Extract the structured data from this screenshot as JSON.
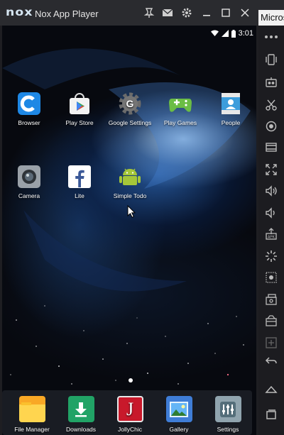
{
  "window": {
    "logo": "nox",
    "title": "Nox App Player",
    "buttons": [
      "pin-icon",
      "mail-icon",
      "settings-icon",
      "minimize-icon",
      "maximize-icon",
      "close-icon"
    ]
  },
  "side_window": {
    "tab_text": "Micros"
  },
  "status_bar": {
    "time": "3:01",
    "icons": [
      "wifi-icon",
      "signal-icon",
      "battery-icon"
    ]
  },
  "home_apps": [
    {
      "label": "Browser",
      "icon": "browser-icon"
    },
    {
      "label": "Play Store",
      "icon": "play-store-icon"
    },
    {
      "label": "Google Settings",
      "icon": "google-settings-icon"
    },
    {
      "label": "Play Games",
      "icon": "play-games-icon"
    },
    {
      "label": "People",
      "icon": "people-icon"
    },
    {
      "label": "Camera",
      "icon": "camera-icon"
    },
    {
      "label": "Lite",
      "icon": "facebook-lite-icon"
    },
    {
      "label": "Simple Todo",
      "icon": "android-icon"
    }
  ],
  "dock": [
    {
      "label": "File Manager",
      "icon": "folder-icon"
    },
    {
      "label": "Downloads",
      "icon": "download-icon"
    },
    {
      "label": "JollyChic",
      "icon": "jollychic-icon",
      "glyph": "J"
    },
    {
      "label": "Gallery",
      "icon": "gallery-icon"
    },
    {
      "label": "Settings",
      "icon": "settings-sliders-icon"
    }
  ],
  "toolbar_icons": [
    "shake-icon",
    "robot-icon",
    "scissors-icon",
    "location-icon",
    "screen-icon",
    "fullscreen-icon",
    "volume-up-icon",
    "volume-down-icon",
    "apk-install-icon",
    "loading-icon",
    "controller-icon",
    "multi-instance-icon",
    "record-icon",
    "keymap-icon",
    "back-icon",
    "home-icon",
    "recent-apps-icon"
  ],
  "colors": {
    "titlebar": "#2a2b2f",
    "toolbar": "#1c1c20",
    "android_green": "#a4c639",
    "jollychic_red": "#c8192b"
  }
}
